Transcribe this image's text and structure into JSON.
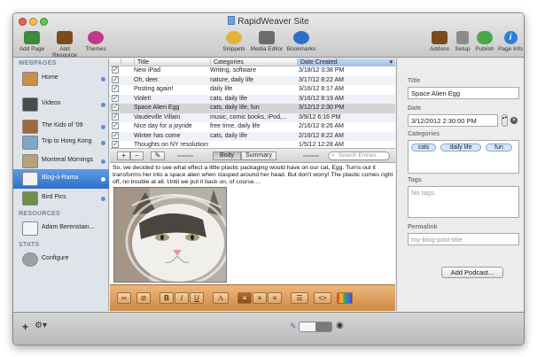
{
  "window": {
    "title": "RapidWeaver Site"
  },
  "toolbar": {
    "left": [
      {
        "label": "Add Page",
        "icon": "add-page-icon",
        "color": "#3f8a3a"
      },
      {
        "label": "Add Resource",
        "icon": "add-resource-icon",
        "color": "#7a4b1f"
      },
      {
        "label": "Themes",
        "icon": "themes-icon",
        "color": "#c0388c"
      }
    ],
    "center": [
      {
        "label": "Snippets",
        "icon": "snippets-icon",
        "color": "#e2b23b"
      },
      {
        "label": "Media Editor",
        "icon": "media-editor-icon",
        "color": "#6c6c6c"
      },
      {
        "label": "Bookmarks",
        "icon": "bookmarks-icon",
        "color": "#2f6fc9"
      }
    ],
    "right": [
      {
        "label": "Addons",
        "icon": "addons-icon",
        "color": "#7a4b1f"
      },
      {
        "label": "Setup",
        "icon": "setup-icon",
        "color": "#8c8c8c"
      },
      {
        "label": "Publish",
        "icon": "publish-icon",
        "color": "#4aa64a"
      },
      {
        "label": "Page Info",
        "icon": "page-info-icon",
        "color": "#2f7fd8"
      }
    ]
  },
  "sidebar": {
    "webpages_heading": "WEBPAGES",
    "pages": [
      {
        "label": "Home",
        "selected": false,
        "thumb": "#c98d4c"
      },
      {
        "label": "Videos",
        "selected": false,
        "thumb": "#4a4a4a"
      },
      {
        "label": "The Kids of '09",
        "selected": false,
        "thumb": "#9c6b3c"
      },
      {
        "label": "Trip to Hong Kong",
        "selected": false,
        "thumb": "#7fa6c9"
      },
      {
        "label": "Montreal Mornings",
        "selected": false,
        "thumb": "#b3a27a"
      },
      {
        "label": "Blog-o-Rama",
        "selected": true,
        "thumb": "#f2f2f2"
      },
      {
        "label": "Bird Pics",
        "selected": false,
        "thumb": "#6d8f4a"
      }
    ],
    "resources_heading": "RESOURCES",
    "resources": [
      {
        "label": "Adam Berenstain..."
      }
    ],
    "stats_heading": "STATS",
    "stats": [
      {
        "label": "Configure"
      }
    ]
  },
  "entries": {
    "columns": {
      "title": "Title",
      "categories": "Categories",
      "date": "Date Created"
    },
    "rows": [
      {
        "title": "New iPad",
        "categories": "Writing,  software",
        "date": "3/18/12 3:38 PM",
        "checked": true
      },
      {
        "title": "Oh, deer.",
        "categories": "nature,  daily life",
        "date": "3/17/12 8:22 AM",
        "checked": true
      },
      {
        "title": "Posting again!",
        "categories": "daily life",
        "date": "3/16/12 8:17 AM",
        "checked": true
      },
      {
        "title": "Violet!",
        "categories": "cats,  daily life",
        "date": "3/16/12 8:19 AM",
        "checked": true
      },
      {
        "title": "Space Alien Egg",
        "categories": "cats,  daily life,  fun",
        "date": "3/12/12 2:30 PM",
        "checked": true
      },
      {
        "title": "Vaudeville Villain",
        "categories": "music,  comic books,  iPod,...",
        "date": "3/9/12 6:16 PM",
        "checked": true
      },
      {
        "title": "Nice day for a joyride",
        "categories": "free time,  daily life",
        "date": "2/16/12 8:26 AM",
        "checked": true
      },
      {
        "title": "Winter has come",
        "categories": "cats,  daily life",
        "date": "2/16/12 8:22 AM",
        "checked": true
      },
      {
        "title": "Thoughts on NY resolutions",
        "categories": "",
        "date": "1/5/12 12:28 AM",
        "checked": true
      }
    ],
    "selected_index": 4
  },
  "listbar": {
    "add": "+",
    "remove": "−",
    "edit_icon": "pencil-icon",
    "segments": [
      "Body",
      "Summary"
    ],
    "active_segment": 0,
    "search_placeholder": "Search Entries"
  },
  "editor": {
    "body": "So, we decided to see what effect a little plastic packaging would have on our cat, Egg. Turns out it transforms her into a space alien when clasped around her head. But don't worry! The plastic comes right off, no trouble at all. Until we put it back on, of course....",
    "image_alt": "cat-photo"
  },
  "format_bar": {
    "bold": "B",
    "italic": "I",
    "underline": "U",
    "font": "A"
  },
  "inspector": {
    "title_label": "Title",
    "title_value": "Space Alien Egg",
    "date_label": "Date",
    "date_value": "3/12/2012  2:30:00 PM",
    "categories_label": "Categories",
    "categories": [
      "cats",
      "daily life",
      "fun"
    ],
    "tags_label": "Tags",
    "tags_placeholder": "No tags.",
    "permalink_label": "Permalink",
    "permalink_placeholder": "my-blog-post-title",
    "podcast_button": "Add Podcast..."
  },
  "bottombar": {
    "add": "+",
    "gear_icon": "gear-icon"
  },
  "colors": {
    "selection_blue": "#2f6fc9",
    "format_bar": "#d99a55",
    "sidebar_bg": "#dfe4ea"
  }
}
